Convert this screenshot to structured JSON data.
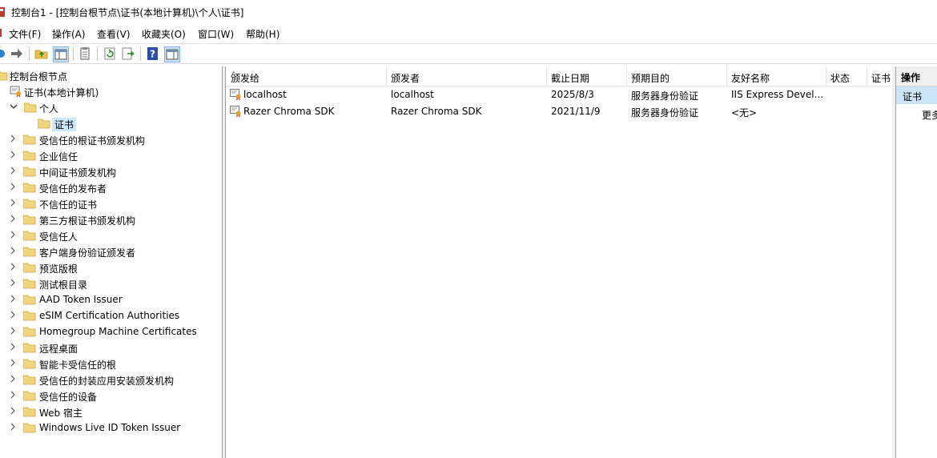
{
  "window": {
    "title": "控制台1 - [控制台根节点\\证书(本地计算机)\\个人\\证书]"
  },
  "menu": [
    "文件(F)",
    "操作(A)",
    "查看(V)",
    "收藏夹(O)",
    "窗口(W)",
    "帮助(H)"
  ],
  "toolbar": {
    "icons": [
      "back-icon",
      "forward-icon",
      "up-folder-icon",
      "show-hide-tree-icon",
      "properties-icon",
      "refresh-icon",
      "export-list-icon",
      "help-icon",
      "show-hide-action-pane-icon"
    ]
  },
  "tree": {
    "root": "控制台根节点",
    "store": "证书(本地计算机)",
    "personal": "个人",
    "certificates": "证书",
    "items": [
      "受信任的根证书颁发机构",
      "企业信任",
      "中间证书颁发机构",
      "受信任的发布者",
      "不信任的证书",
      "第三方根证书颁发机构",
      "受信任人",
      "客户端身份验证颁发者",
      "预览版根",
      "测试根目录",
      "AAD Token Issuer",
      "eSIM Certification Authorities",
      "Homegroup Machine Certificates",
      "远程桌面",
      "智能卡受信任的根",
      "受信任的封装应用安装颁发机构",
      "受信任的设备",
      "Web 宿主",
      "Windows Live ID Token Issuer"
    ]
  },
  "list": {
    "columns": [
      "颁发给",
      "颁发者",
      "截止日期",
      "预期目的",
      "友好名称",
      "状态",
      "证书"
    ],
    "rows": [
      [
        "localhost",
        "localhost",
        "2025/8/3",
        "服务器身份验证",
        "IIS Express Devel..."
      ],
      [
        "Razer Chroma SDK",
        "Razer Chroma SDK",
        "2021/11/9",
        "服务器身份验证",
        "<无>"
      ]
    ]
  },
  "actions": {
    "header": "操作",
    "section": "证书",
    "more": "更多"
  },
  "colors": {
    "selection": "#cce8ff",
    "folder": "#f3d57a",
    "border": "#a0a0a0"
  }
}
